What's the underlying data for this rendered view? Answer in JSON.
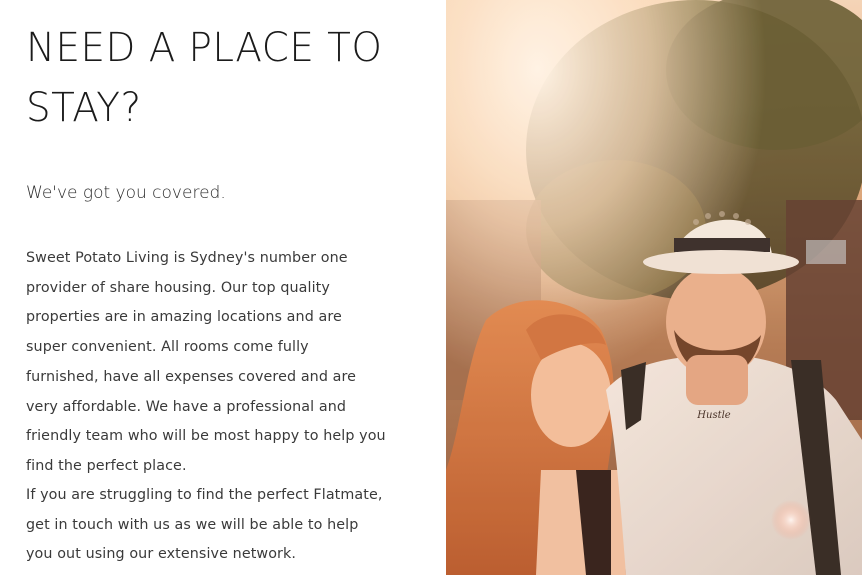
{
  "headline": "NEED A PLACE TO STAY?",
  "subheadline": "We've got you covered.",
  "paragraphs": [
    "Sweet Potato Living is Sydney's number one provider of share housing. Our top quality properties are in amazing locations and are super convenient. All rooms come fully furnished, have all expenses covered and are very affordable. We have a professional and friendly team who will be most happy to help you find the perfect place.",
    "If you are struggling to find the perfect Flatmate, get in touch with us as we will be able to help you out using our extensive network."
  ],
  "hero_image": {
    "tattoo_text": "Hustle"
  },
  "colors": {
    "text": "#1e1e1e",
    "background": "#ffffff",
    "photo_warm": "#d9a77c"
  }
}
